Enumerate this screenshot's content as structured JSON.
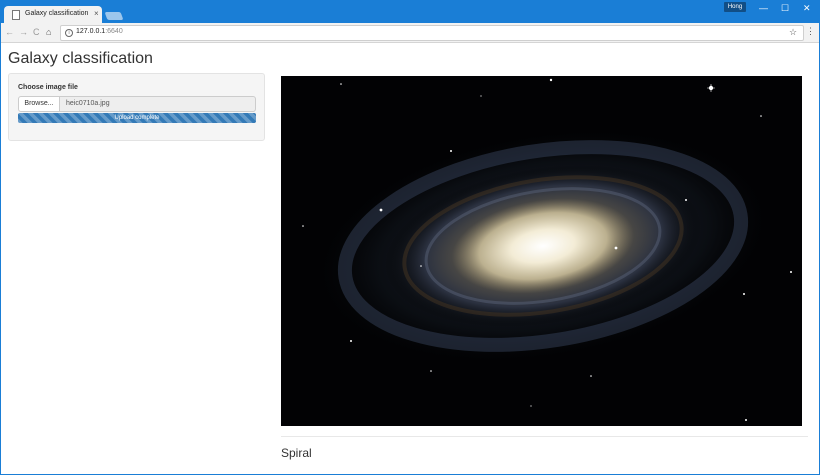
{
  "browser": {
    "tab_title": "Galaxy classification",
    "tab_close": "×",
    "profile_name": "Hong",
    "url_host": "127.0.0.1",
    "url_port": ":6640",
    "nav_back": "←",
    "nav_forward": "→",
    "nav_reload": "C",
    "nav_home": "⌂",
    "star_icon": "☆",
    "menu_icon": "⋮",
    "win_minimize": "—",
    "win_maximize": "☐",
    "win_close": "✕"
  },
  "page": {
    "title": "Galaxy classification",
    "file_input": {
      "label": "Choose image file",
      "browse_label": "Browse...",
      "file_name": "heic0710a.jpg",
      "progress_text": "Upload complete",
      "progress_fraction": 1.0
    },
    "result_label": "Spiral"
  },
  "colors": {
    "titlebar": "#1a7ed6",
    "progress": "#337ab7"
  }
}
